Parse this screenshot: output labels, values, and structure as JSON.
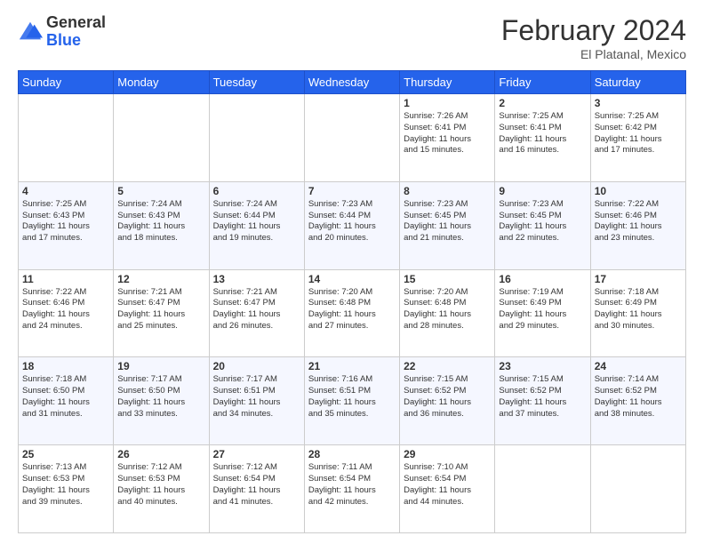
{
  "header": {
    "logo_general": "General",
    "logo_blue": "Blue",
    "month_year": "February 2024",
    "location": "El Platanal, Mexico"
  },
  "weekdays": [
    "Sunday",
    "Monday",
    "Tuesday",
    "Wednesday",
    "Thursday",
    "Friday",
    "Saturday"
  ],
  "weeks": [
    [
      {
        "day": "",
        "info": ""
      },
      {
        "day": "",
        "info": ""
      },
      {
        "day": "",
        "info": ""
      },
      {
        "day": "",
        "info": ""
      },
      {
        "day": "1",
        "info": "Sunrise: 7:26 AM\nSunset: 6:41 PM\nDaylight: 11 hours\nand 15 minutes."
      },
      {
        "day": "2",
        "info": "Sunrise: 7:25 AM\nSunset: 6:41 PM\nDaylight: 11 hours\nand 16 minutes."
      },
      {
        "day": "3",
        "info": "Sunrise: 7:25 AM\nSunset: 6:42 PM\nDaylight: 11 hours\nand 17 minutes."
      }
    ],
    [
      {
        "day": "4",
        "info": "Sunrise: 7:25 AM\nSunset: 6:43 PM\nDaylight: 11 hours\nand 17 minutes."
      },
      {
        "day": "5",
        "info": "Sunrise: 7:24 AM\nSunset: 6:43 PM\nDaylight: 11 hours\nand 18 minutes."
      },
      {
        "day": "6",
        "info": "Sunrise: 7:24 AM\nSunset: 6:44 PM\nDaylight: 11 hours\nand 19 minutes."
      },
      {
        "day": "7",
        "info": "Sunrise: 7:23 AM\nSunset: 6:44 PM\nDaylight: 11 hours\nand 20 minutes."
      },
      {
        "day": "8",
        "info": "Sunrise: 7:23 AM\nSunset: 6:45 PM\nDaylight: 11 hours\nand 21 minutes."
      },
      {
        "day": "9",
        "info": "Sunrise: 7:23 AM\nSunset: 6:45 PM\nDaylight: 11 hours\nand 22 minutes."
      },
      {
        "day": "10",
        "info": "Sunrise: 7:22 AM\nSunset: 6:46 PM\nDaylight: 11 hours\nand 23 minutes."
      }
    ],
    [
      {
        "day": "11",
        "info": "Sunrise: 7:22 AM\nSunset: 6:46 PM\nDaylight: 11 hours\nand 24 minutes."
      },
      {
        "day": "12",
        "info": "Sunrise: 7:21 AM\nSunset: 6:47 PM\nDaylight: 11 hours\nand 25 minutes."
      },
      {
        "day": "13",
        "info": "Sunrise: 7:21 AM\nSunset: 6:47 PM\nDaylight: 11 hours\nand 26 minutes."
      },
      {
        "day": "14",
        "info": "Sunrise: 7:20 AM\nSunset: 6:48 PM\nDaylight: 11 hours\nand 27 minutes."
      },
      {
        "day": "15",
        "info": "Sunrise: 7:20 AM\nSunset: 6:48 PM\nDaylight: 11 hours\nand 28 minutes."
      },
      {
        "day": "16",
        "info": "Sunrise: 7:19 AM\nSunset: 6:49 PM\nDaylight: 11 hours\nand 29 minutes."
      },
      {
        "day": "17",
        "info": "Sunrise: 7:18 AM\nSunset: 6:49 PM\nDaylight: 11 hours\nand 30 minutes."
      }
    ],
    [
      {
        "day": "18",
        "info": "Sunrise: 7:18 AM\nSunset: 6:50 PM\nDaylight: 11 hours\nand 31 minutes."
      },
      {
        "day": "19",
        "info": "Sunrise: 7:17 AM\nSunset: 6:50 PM\nDaylight: 11 hours\nand 33 minutes."
      },
      {
        "day": "20",
        "info": "Sunrise: 7:17 AM\nSunset: 6:51 PM\nDaylight: 11 hours\nand 34 minutes."
      },
      {
        "day": "21",
        "info": "Sunrise: 7:16 AM\nSunset: 6:51 PM\nDaylight: 11 hours\nand 35 minutes."
      },
      {
        "day": "22",
        "info": "Sunrise: 7:15 AM\nSunset: 6:52 PM\nDaylight: 11 hours\nand 36 minutes."
      },
      {
        "day": "23",
        "info": "Sunrise: 7:15 AM\nSunset: 6:52 PM\nDaylight: 11 hours\nand 37 minutes."
      },
      {
        "day": "24",
        "info": "Sunrise: 7:14 AM\nSunset: 6:52 PM\nDaylight: 11 hours\nand 38 minutes."
      }
    ],
    [
      {
        "day": "25",
        "info": "Sunrise: 7:13 AM\nSunset: 6:53 PM\nDaylight: 11 hours\nand 39 minutes."
      },
      {
        "day": "26",
        "info": "Sunrise: 7:12 AM\nSunset: 6:53 PM\nDaylight: 11 hours\nand 40 minutes."
      },
      {
        "day": "27",
        "info": "Sunrise: 7:12 AM\nSunset: 6:54 PM\nDaylight: 11 hours\nand 41 minutes."
      },
      {
        "day": "28",
        "info": "Sunrise: 7:11 AM\nSunset: 6:54 PM\nDaylight: 11 hours\nand 42 minutes."
      },
      {
        "day": "29",
        "info": "Sunrise: 7:10 AM\nSunset: 6:54 PM\nDaylight: 11 hours\nand 44 minutes."
      },
      {
        "day": "",
        "info": ""
      },
      {
        "day": "",
        "info": ""
      }
    ]
  ]
}
